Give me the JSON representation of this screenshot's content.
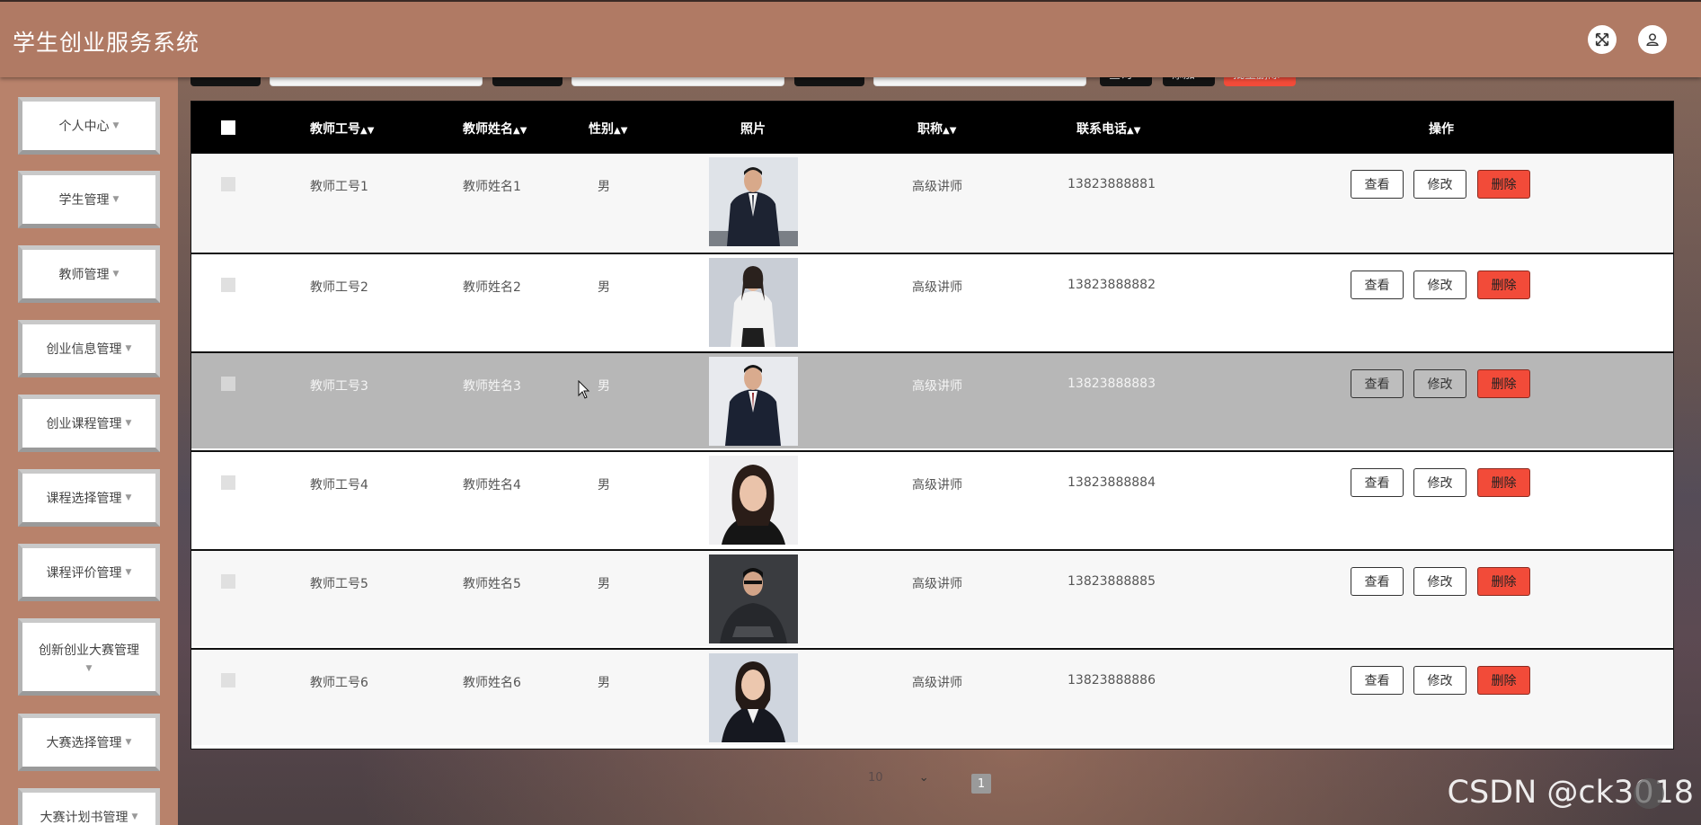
{
  "header": {
    "title": "学生创业服务系统"
  },
  "sidebar": {
    "items": [
      {
        "label": "个人中心"
      },
      {
        "label": "学生管理"
      },
      {
        "label": "教师管理"
      },
      {
        "label": "创业信息管理"
      },
      {
        "label": "创业课程管理"
      },
      {
        "label": "课程选择管理"
      },
      {
        "label": "课程评价管理"
      },
      {
        "label": "创新创业大赛管理"
      },
      {
        "label": "大赛选择管理"
      },
      {
        "label": "大赛计划书管理"
      }
    ]
  },
  "table": {
    "columns": {
      "id": "教师工号",
      "name": "教师姓名",
      "gender": "性别",
      "photo": "照片",
      "title": "职称",
      "phone": "联系电话",
      "actions": "操作"
    },
    "rows": [
      {
        "id": "教师工号1",
        "name": "教师姓名1",
        "gender": "男",
        "title": "高级讲师",
        "phone": "13823888881"
      },
      {
        "id": "教师工号2",
        "name": "教师姓名2",
        "gender": "男",
        "title": "高级讲师",
        "phone": "13823888882"
      },
      {
        "id": "教师工号3",
        "name": "教师姓名3",
        "gender": "男",
        "title": "高级讲师",
        "phone": "13823888883"
      },
      {
        "id": "教师工号4",
        "name": "教师姓名4",
        "gender": "男",
        "title": "高级讲师",
        "phone": "13823888884"
      },
      {
        "id": "教师工号5",
        "name": "教师姓名5",
        "gender": "男",
        "title": "高级讲师",
        "phone": "13823888885"
      },
      {
        "id": "教师工号6",
        "name": "教师姓名6",
        "gender": "男",
        "title": "高级讲师",
        "phone": "13823888886"
      }
    ],
    "actions": {
      "view": "查看",
      "edit": "修改",
      "delete": "删除"
    },
    "highlighted_row": 3
  },
  "toolbar": {
    "query": "查询",
    "add": "添加",
    "batch_delete": "批量删除"
  },
  "pager": {
    "page_size": "10",
    "current_page": "1"
  },
  "watermark": "CSDN @ck3018",
  "colors": {
    "header": "#b07a64",
    "sidebar": "#b8826b",
    "danger": "#f24b39",
    "table_head": "#000000"
  }
}
